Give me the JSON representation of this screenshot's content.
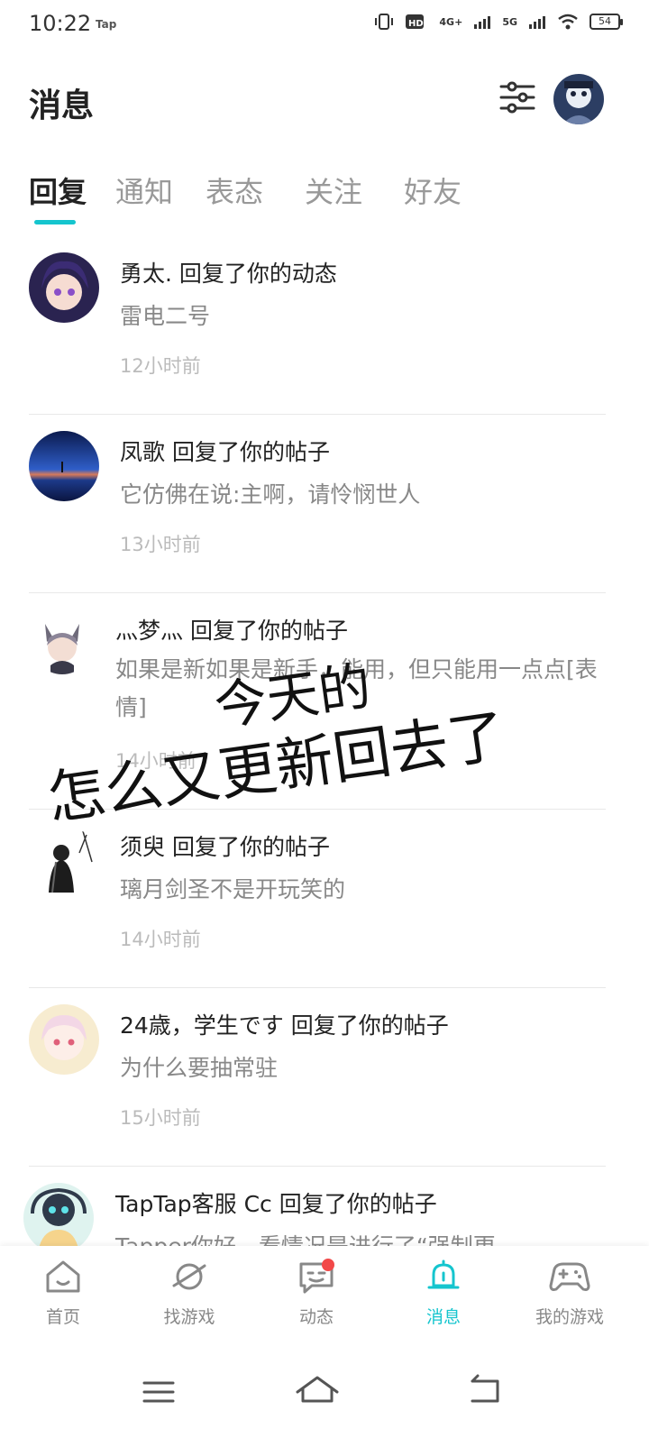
{
  "status_bar": {
    "time": "10:22",
    "app_badge": "Tap",
    "network_4g": "4G+",
    "network_5g": "5G",
    "battery": "54"
  },
  "header": {
    "title": "消息"
  },
  "tabs": [
    {
      "label": "回复",
      "active": true
    },
    {
      "label": "通知",
      "active": false
    },
    {
      "label": "表态",
      "active": false
    },
    {
      "label": "关注",
      "active": false
    },
    {
      "label": "好友",
      "active": false
    }
  ],
  "messages": [
    {
      "title": "勇太. 回复了你的动态",
      "preview": "雷电二号",
      "time": "12小时前"
    },
    {
      "title": "凤歌  回复了你的帖子",
      "preview": "它仿佛在说:主啊，请怜悯世人",
      "time": "13小时前"
    },
    {
      "title": "灬梦灬  回复了你的帖子",
      "preview": "如果是新如果是新手，能用，但只能用一点点[表情]",
      "time": "14小时前"
    },
    {
      "title": "须臾  回复了你的帖子",
      "preview": "璃月剑圣不是开玩笑的",
      "time": "14小时前"
    },
    {
      "title": "24歳，学生です  回复了你的帖子",
      "preview": "为什么要抽常驻",
      "time": "15小时前"
    },
    {
      "title": "TapTap客服  Cc  回复了你的帖子",
      "preview": "Tapper你好，看情况是进行了“强制更",
      "time": ""
    }
  ],
  "overlay": {
    "line1": "今天的",
    "line2": "怎么又更新回去了"
  },
  "bottom_nav": [
    {
      "label": "首页",
      "icon": "home-icon",
      "active": false
    },
    {
      "label": "找游戏",
      "icon": "planet-icon",
      "active": false
    },
    {
      "label": "动态",
      "icon": "chat-icon",
      "active": false
    },
    {
      "label": "消息",
      "icon": "bell-icon",
      "active": true
    },
    {
      "label": "我的游戏",
      "icon": "gamepad-icon",
      "active": false
    }
  ],
  "colors": {
    "accent": "#15c5ce",
    "badge": "#f24848"
  }
}
